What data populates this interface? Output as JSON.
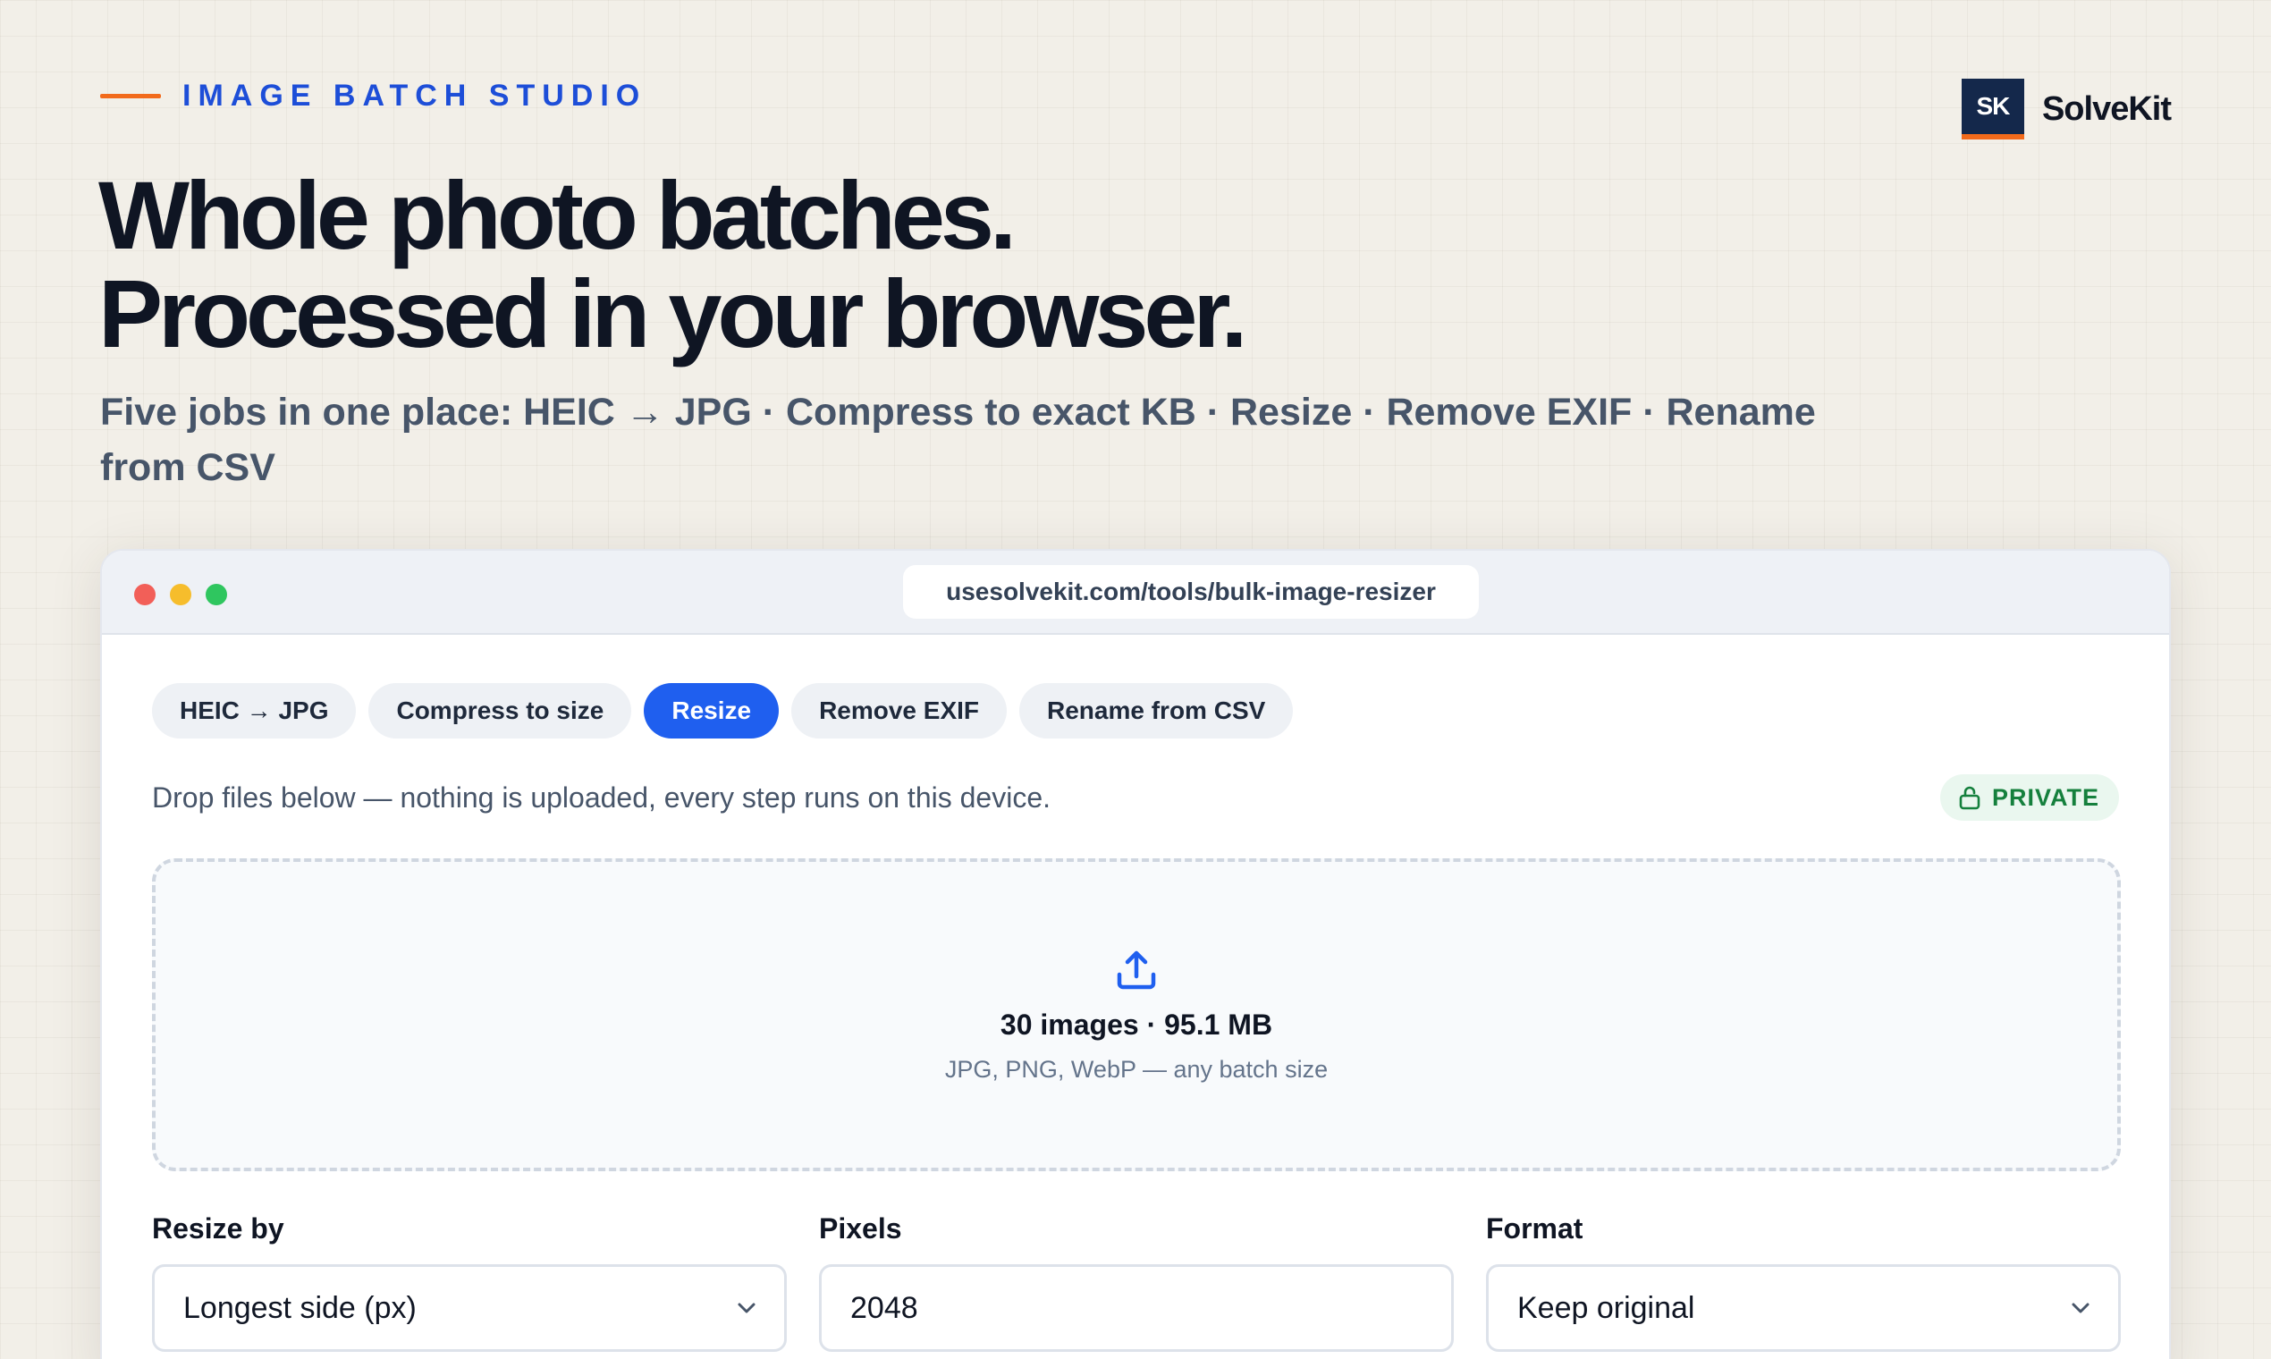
{
  "eyebrow": "IMAGE BATCH STUDIO",
  "brand": {
    "mark": "SK",
    "name": "SolveKit"
  },
  "headline": {
    "line1": "Whole photo batches.",
    "line2": "Processed in your browser."
  },
  "subhead": "Five jobs in one place: HEIC → JPG · Compress to exact KB · Resize · Remove EXIF · Rename from CSV",
  "browser": {
    "url": "usesolvekit.com/tools/bulk-image-resizer"
  },
  "tabs": [
    {
      "label": "HEIC → JPG",
      "active": false
    },
    {
      "label": "Compress to size",
      "active": false
    },
    {
      "label": "Resize",
      "active": true
    },
    {
      "label": "Remove EXIF",
      "active": false
    },
    {
      "label": "Rename from CSV",
      "active": false
    }
  ],
  "note": "Drop files below — nothing is uploaded, every step runs on this device.",
  "badge": "PRIVATE",
  "dropzone": {
    "icon": "upload-icon",
    "count": "30 images · 95.1 MB",
    "hint": "JPG, PNG, WebP — any batch size"
  },
  "fields": {
    "resize_by": {
      "label": "Resize by",
      "value": "Longest side (px)"
    },
    "pixels": {
      "label": "Pixels",
      "value": "2048"
    },
    "format": {
      "label": "Format",
      "value": "Keep original"
    }
  },
  "colors": {
    "accent": "#1f5fef",
    "brand_navy": "#14284b",
    "orange": "#f26a1b",
    "private_green": "#15803d"
  }
}
